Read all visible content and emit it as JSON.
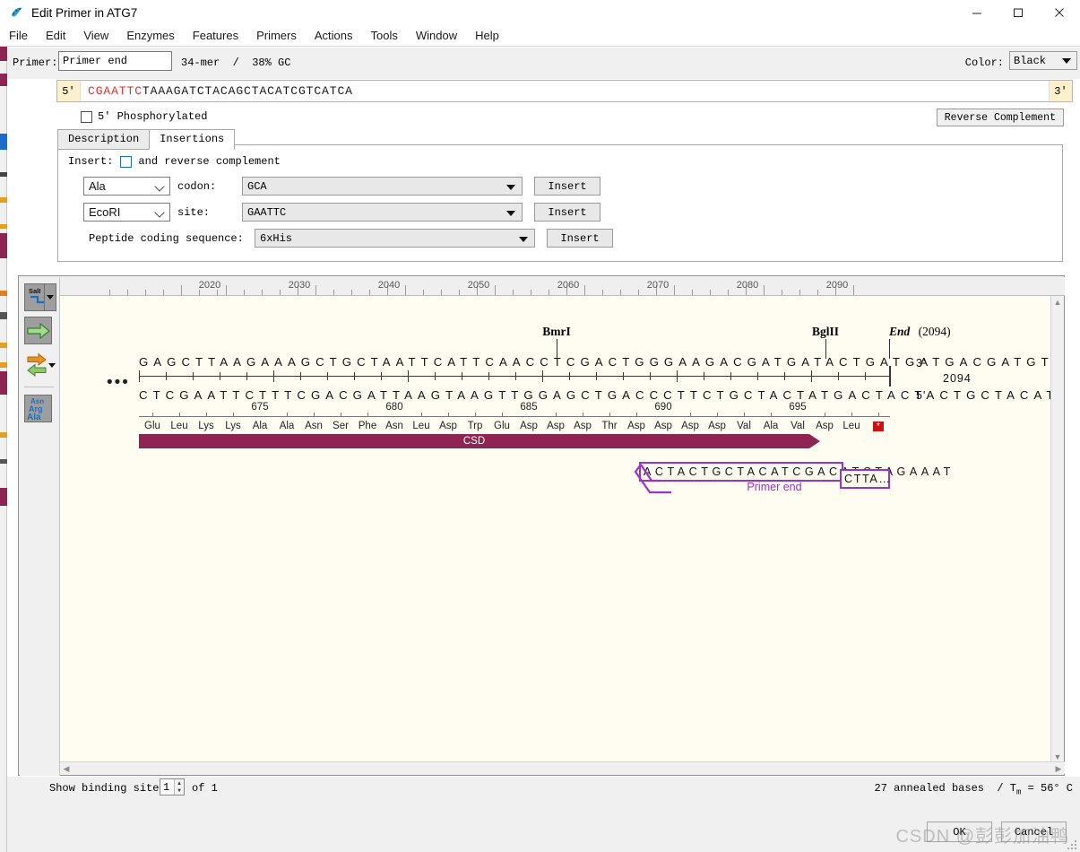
{
  "window": {
    "title": "Edit Primer in ATG7",
    "app_icon": "snapgene-icon",
    "minimize": "minimize-icon",
    "maximize": "maximize-icon",
    "close": "close-icon"
  },
  "menu": {
    "items": [
      "File",
      "Edit",
      "View",
      "Enzymes",
      "Features",
      "Primers",
      "Actions",
      "Tools",
      "Window",
      "Help"
    ]
  },
  "primer": {
    "label": "Primer:",
    "name_value": "Primer end",
    "name_placeholder": "Primer name",
    "stats": "34-mer  /  38% GC",
    "color_label": "Color:",
    "color_value": "Black",
    "end5": "5'",
    "end3": "3'",
    "sequence_prefix": "CGAATTC",
    "sequence_body": "TAAAGATCTACAGCTACATCGTCATCA",
    "prefix_color": "#e03030",
    "phosphorylated_label": "5' Phosphorylated",
    "phosphorylated_checked": false,
    "reverse_complement": "Reverse Complement"
  },
  "tabs": {
    "items": [
      {
        "label": "Description",
        "active": false
      },
      {
        "label": "Insertions",
        "active": true
      }
    ]
  },
  "insertions": {
    "insert_label": "Insert:",
    "revcomp_label": "and reverse complement",
    "revcomp_checked": false,
    "rows": [
      {
        "select": "Ala",
        "mid_label": "codon:",
        "value": "GCA",
        "button": "Insert"
      },
      {
        "select": "EcoRI",
        "mid_label": "site:",
        "value": "GAATTC",
        "button": "Insert"
      }
    ],
    "peptide_label": "Peptide coding sequence:",
    "peptide_value": "6xHis",
    "peptide_button": "Insert"
  },
  "map_toolbar": {
    "enzyme_tool": "SalI",
    "enzyme_tool_name": "enzyme-cut-icon",
    "arrow_tool_name": "green-arrow-icon",
    "strand_tool_name": "two-arrows-icon",
    "translate_tool_lines": [
      "Asn",
      "Arg",
      "Ala"
    ]
  },
  "map": {
    "ruler_labels": [
      "2020",
      "2030",
      "2040",
      "2050",
      "2060",
      "2070",
      "2080",
      "2090"
    ],
    "top_strand": "GAGCTTAAGAAAGCTGCTAATTCATTCAACCTCGACTGGGAAGACGATGATACTGATGATGACGATGTAGCTGTAGATCTTTAA",
    "bottom_strand": "CTCGAATTCTTTCGACGATTAAGTAAGTTGGAGCTGACCCTTCTGCTACTATGACTACTACTGCTACATCGACATCTAGAAATT",
    "top_end_label": "3'",
    "bottom_end_label": "5'",
    "position_label": "2094",
    "ellipsis": "•••",
    "enzymes": [
      {
        "name": "BmrI"
      },
      {
        "name": "BglII"
      }
    ],
    "end_marker": {
      "word": "End",
      "position": "(2094)"
    },
    "aa_numbers": [
      "675",
      "680",
      "685",
      "690",
      "695"
    ],
    "amino_acids": [
      "Glu",
      "Leu",
      "Lys",
      "Lys",
      "Ala",
      "Ala",
      "Asn",
      "Ser",
      "Phe",
      "Asn",
      "Leu",
      "Asp",
      "Trp",
      "Glu",
      "Asp",
      "Asp",
      "Asp",
      "Thr",
      "Asp",
      "Asp",
      "Asp",
      "Asp",
      "Val",
      "Ala",
      "Val",
      "Asp",
      "Leu"
    ],
    "stop_codon": "*",
    "feature_name": "CSD",
    "feature_color": "#8e2452",
    "primer_annotation": {
      "sequence": "ACTACTGCTACATCGACATCTAGAAAT",
      "overhang": "CTTA…",
      "label": "Primer end",
      "color": "#9933cc"
    }
  },
  "bottom": {
    "show_binding_site": "Show binding site",
    "binding_site_value": "1",
    "of_label": "of 1",
    "anneal_prefix": "27 annealed bases  / T",
    "anneal_sub": "m",
    "anneal_suffix": " = 56° C",
    "ok": "OK",
    "cancel": "Cancel",
    "watermark": "CSDN @彭彭加油鸭"
  }
}
